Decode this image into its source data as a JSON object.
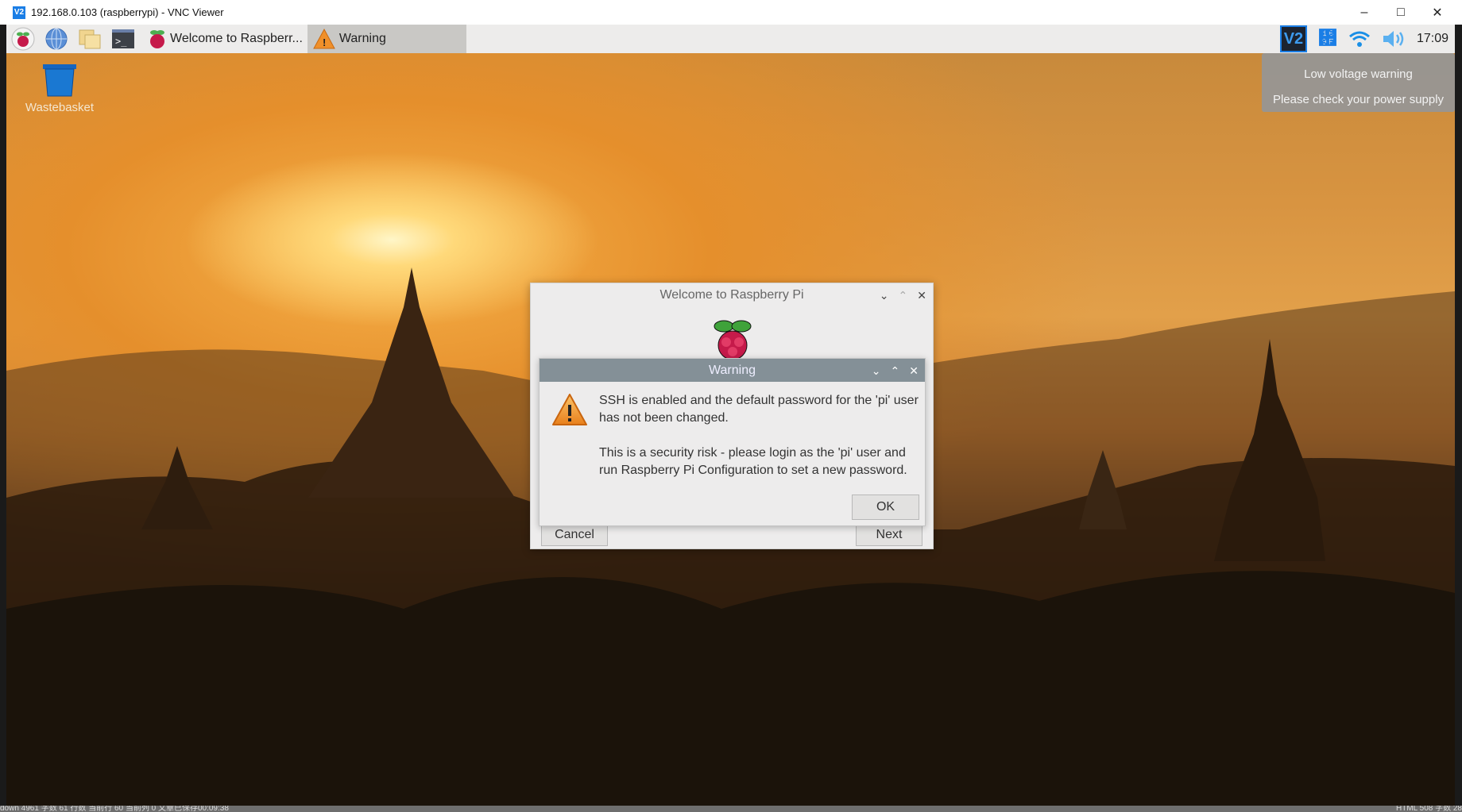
{
  "window": {
    "title": "192.168.0.103 (raspberrypi) - VNC Viewer",
    "logo": "V2",
    "controls": [
      "minimize",
      "maximize",
      "close"
    ]
  },
  "taskbar": {
    "launchers": [
      {
        "icon": "raspberry-menu-icon"
      },
      {
        "icon": "web-browser-globe-icon"
      },
      {
        "icon": "file-manager-folder-icon"
      },
      {
        "icon": "terminal-icon"
      }
    ],
    "tasks": [
      {
        "label": "Welcome to Raspberr...",
        "icon": "raspberry-icon",
        "active": false
      },
      {
        "label": "Warning",
        "icon": "warning-icon",
        "active": true
      }
    ],
    "tray": {
      "icons": [
        "vnc-icon",
        "bluetooth-icon",
        "wifi-icon",
        "volume-icon"
      ],
      "clock": "17:09",
      "accent": "#1a7ee6"
    }
  },
  "desktop": {
    "icons": [
      {
        "label": "Wastebasket",
        "icon": "trash-icon"
      }
    ]
  },
  "notification": {
    "title": "Low voltage warning",
    "body": "Please check your power supply"
  },
  "welcome_dialog": {
    "title": "Welcome to Raspberry Pi",
    "cancel": "Cancel",
    "next": "Next"
  },
  "warning_dialog": {
    "title": "Warning",
    "line1": "SSH is enabled and the default password for the 'pi' user has not been changed.",
    "line2": "This is a security risk - please login as the 'pi' user and run Raspberry Pi Configuration to set a new password.",
    "ok": "OK"
  },
  "host_statusbar": {
    "left": "down  4961 字数  61 行数  当前行 60  当前列 0  文章已保存00:09:38",
    "right": "HTML  508 字数  28"
  }
}
